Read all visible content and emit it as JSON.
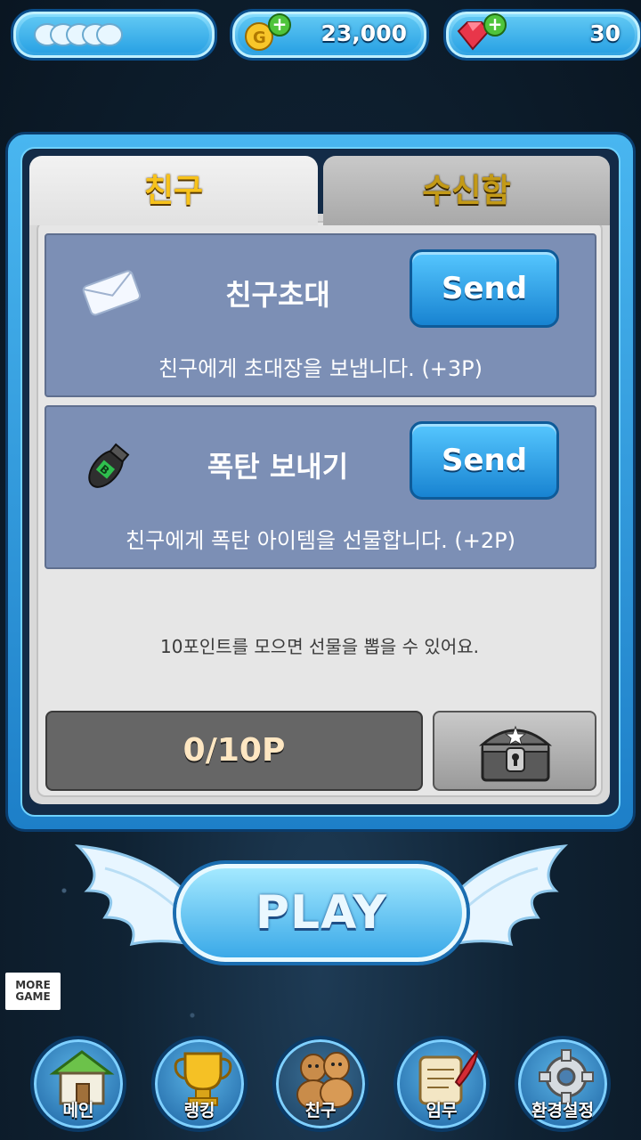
{
  "topbar": {
    "hearts_icon": "hearts-icon",
    "coins": "23,000",
    "gems": "30"
  },
  "tabs": [
    {
      "label": "친구",
      "active": true
    },
    {
      "label": "수신함",
      "active": false
    }
  ],
  "items": [
    {
      "icon": "envelope-icon",
      "title": "친구초대",
      "button": "Send",
      "desc": "친구에게 초대장을 보냅니다. (+3P)"
    },
    {
      "icon": "bomb-icon",
      "title": "폭탄 보내기",
      "button": "Send",
      "desc": "친구에게 폭탄 아이템을 선물합니다. (+2P)"
    }
  ],
  "hint": "10포인트를 모으면 선물을 뽑을 수 있어요.",
  "progress": "0/10P",
  "play_label": "PLAY",
  "more_game": {
    "line1": "MORE",
    "line2": "GAME"
  },
  "nav": [
    {
      "label": "메인",
      "icon": "house-icon"
    },
    {
      "label": "랭킹",
      "icon": "trophy-icon"
    },
    {
      "label": "친구",
      "icon": "friends-icon",
      "active": true
    },
    {
      "label": "임무",
      "icon": "scroll-icon"
    },
    {
      "label": "환경설정",
      "icon": "gear-icon"
    }
  ],
  "colors": {
    "accent": "#2aa2e4",
    "tab_text": "#f7c21b",
    "panel_item": "#7c8fb5"
  }
}
